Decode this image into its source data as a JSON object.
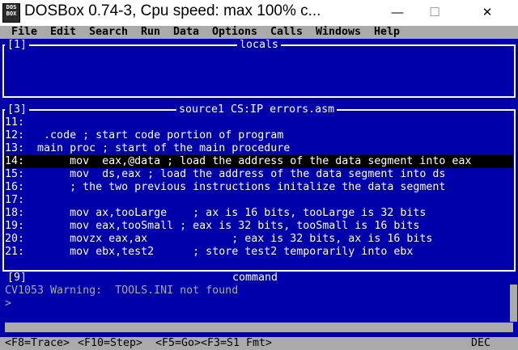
{
  "window": {
    "title": "DOSBox 0.74-3, Cpu speed: max 100% c...",
    "icon_text": [
      "DOS",
      "BOX"
    ],
    "controls": {
      "minimize": "—",
      "maximize": "☐",
      "close": "✕"
    }
  },
  "menu": [
    "File",
    "Edit",
    "Search",
    "Run",
    "Data",
    "Options",
    "Calls",
    "Windows",
    "Help"
  ],
  "panels": {
    "locals": {
      "number": "[1]",
      "title": "locals"
    },
    "source": {
      "number": "[3]",
      "title": "source1 CS:IP errors.asm"
    },
    "command": {
      "number": "[9]",
      "title": "command"
    }
  },
  "source_lines": [
    {
      "num": "11:",
      "text": ""
    },
    {
      "num": "12:",
      "text": "   .code ; start code portion of program"
    },
    {
      "num": "13:",
      "text": "  main proc ; start of the main procedure"
    },
    {
      "num": "14:",
      "text": "       mov  eax,@data ; load the address of the data segment into eax"
    },
    {
      "num": "15:",
      "text": "       mov  ds,eax ; load the address of the data segment into ds"
    },
    {
      "num": "16:",
      "text": "       ; the two previous instructions initalize the data segment"
    },
    {
      "num": "17:",
      "text": ""
    },
    {
      "num": "18:",
      "text": "       mov ax,tooLarge    ; ax is 16 bits, tooLarge is 32 bits"
    },
    {
      "num": "19:",
      "text": "       mov eax,tooSmall ; eax is 32 bits, tooSmall is 16 bits"
    },
    {
      "num": "20:",
      "text": "       movzx eax,ax             ; eax is 32 bits, ax is 16 bits"
    },
    {
      "num": "21:",
      "text": "       mov ebx,test2      ; store test2 temporarily into ebx"
    }
  ],
  "highlighted_line": "14:",
  "command_output": [
    "CV1053 Warning:  TOOLS.INI not found",
    ">"
  ],
  "status": {
    "f8": "<F8=Trace>",
    "f10": "<F10=Step>",
    "f5": "<F5=Go>",
    "f3": "<F3=S1 Fmt>",
    "mode": "DEC"
  },
  "colors": {
    "dos_blue": "#0000aa",
    "dos_gray": "#aaaaaa",
    "highlight": "#000000"
  }
}
